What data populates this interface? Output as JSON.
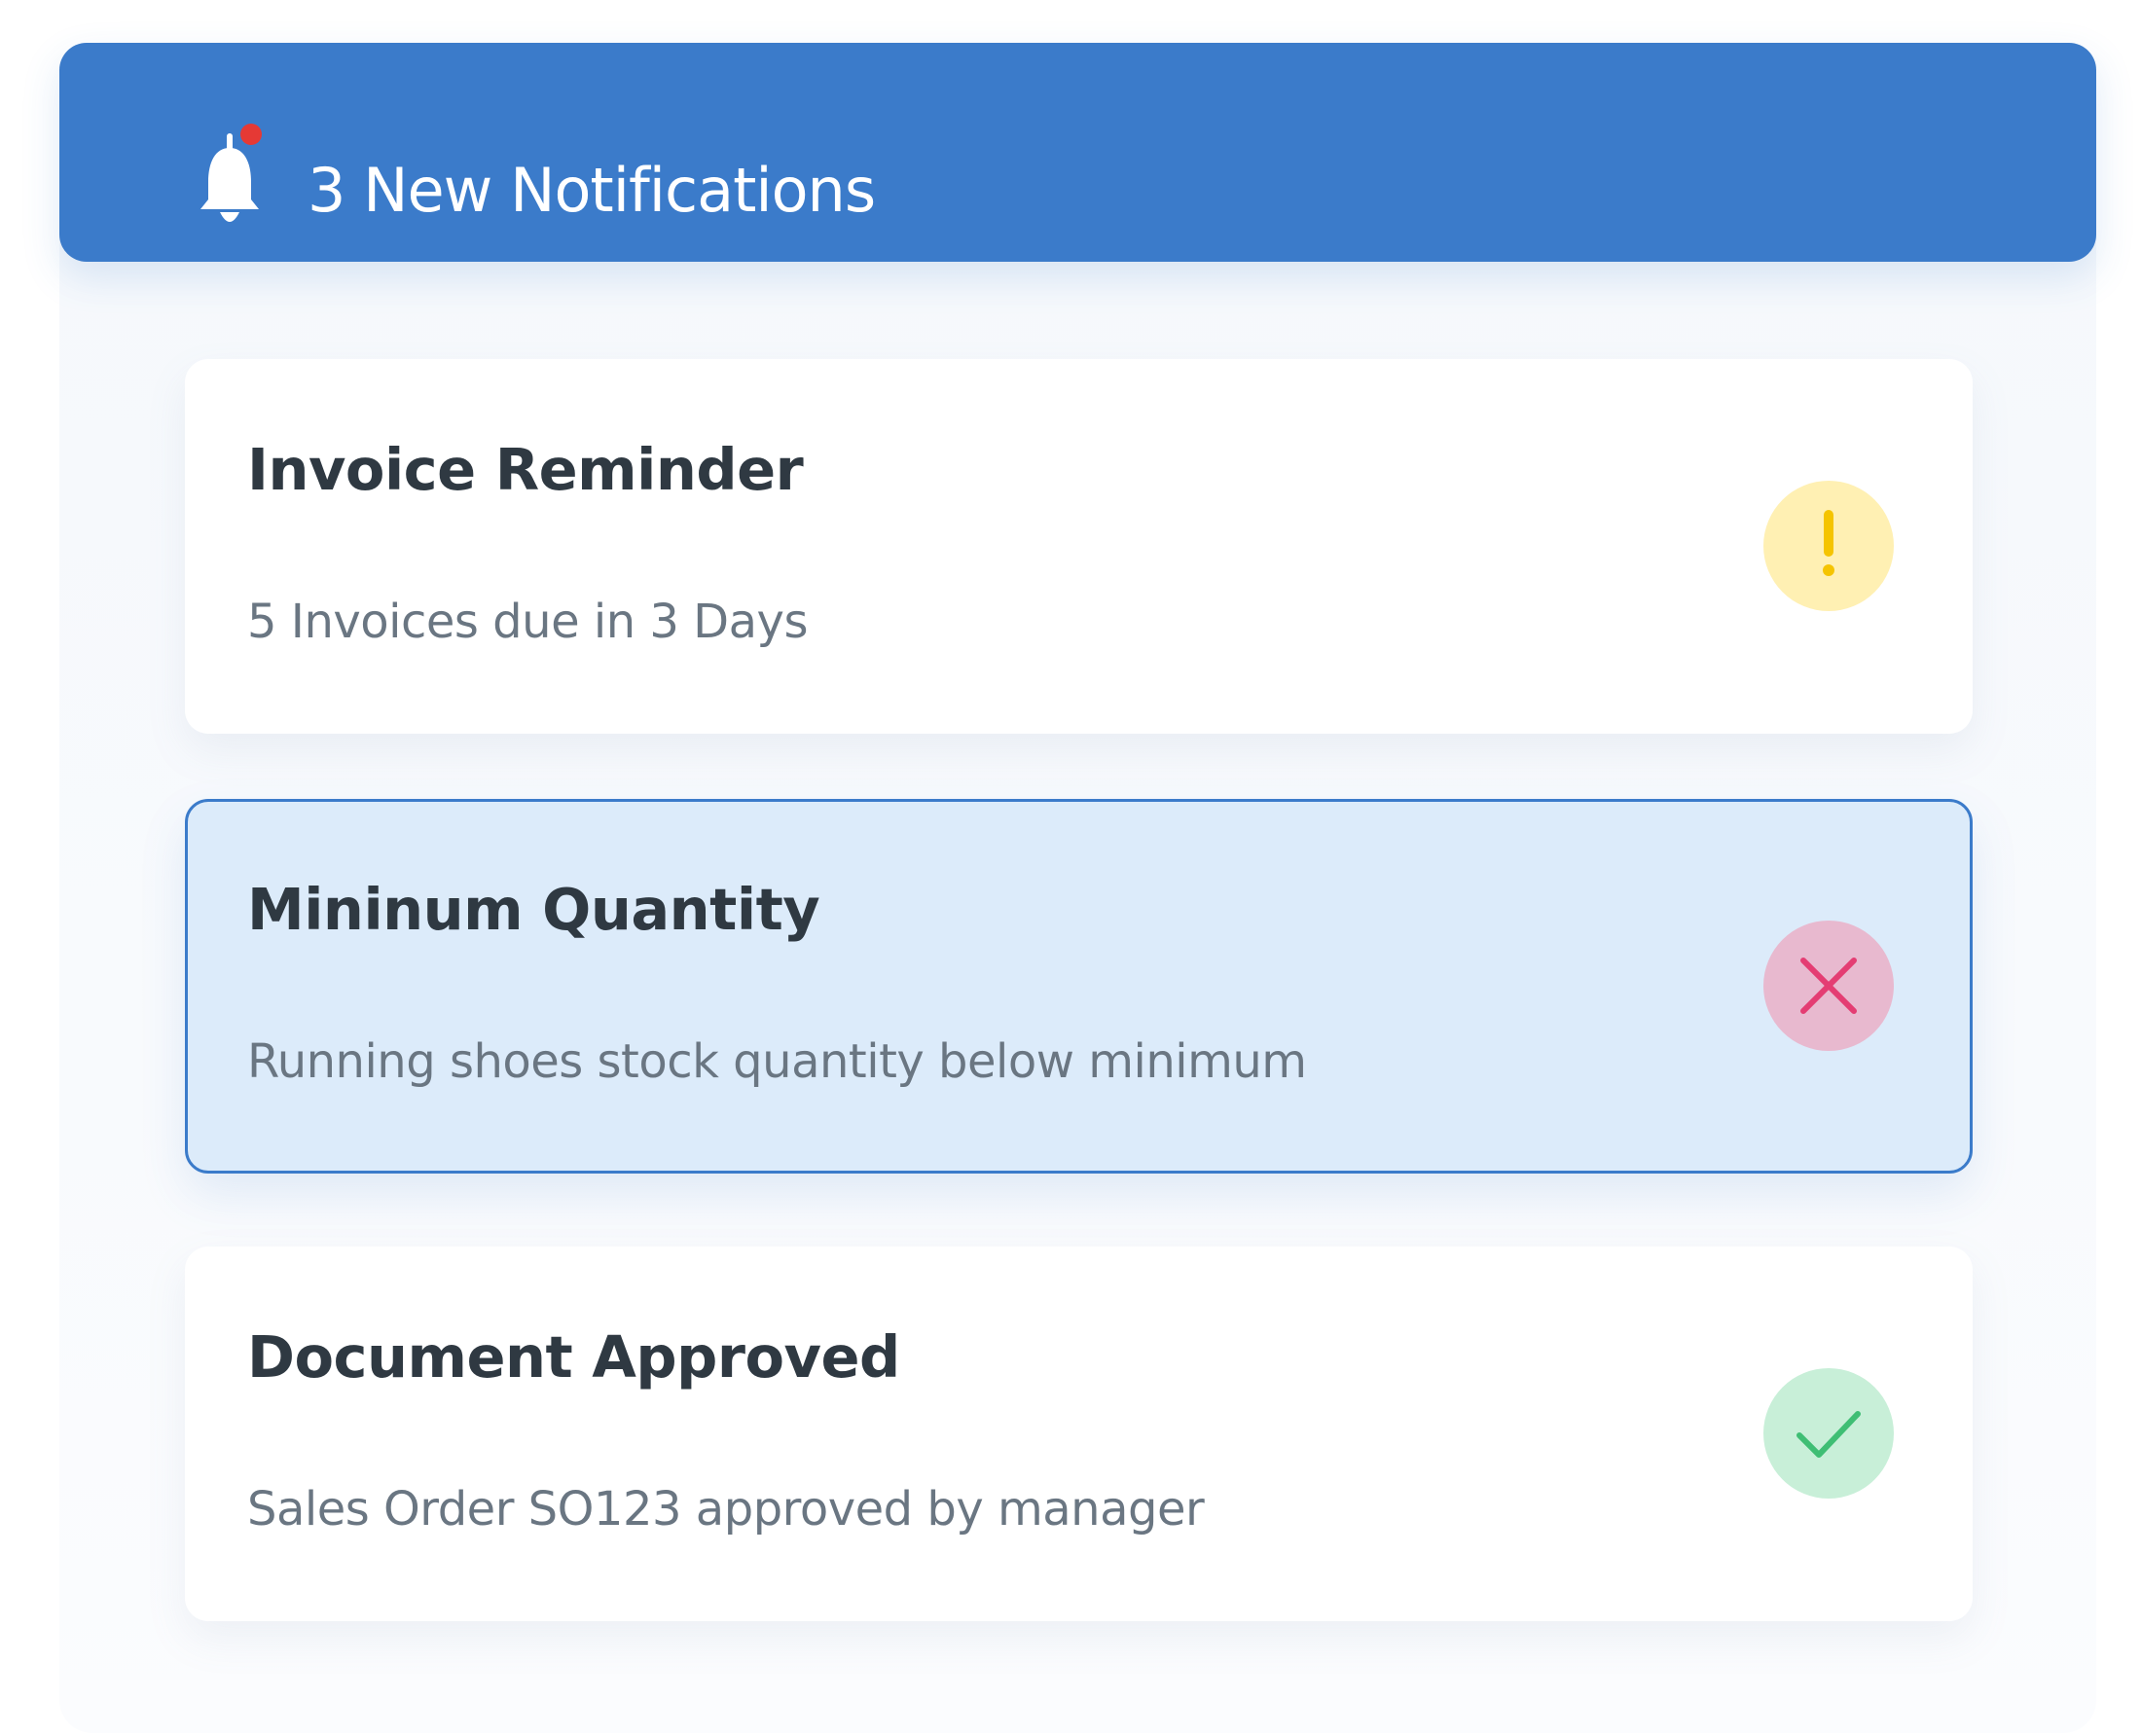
{
  "header": {
    "title": "3 New Notifications",
    "icon": "bell-icon",
    "accent": "#3b7bca",
    "dot_color": "#e53935"
  },
  "notifications": [
    {
      "title": "Invoice Reminder",
      "message": "5 Invoices due in 3 Days",
      "status": "warning",
      "icon": "exclamation-icon",
      "status_bg": "#fff0b3",
      "status_fg": "#f5c400",
      "selected": false
    },
    {
      "title": "Mininum Quantity",
      "message": "Running shoes stock quantity below minimum",
      "status": "error",
      "icon": "close-icon",
      "status_bg": "#e8b9cf",
      "status_fg": "#e43d73",
      "selected": true
    },
    {
      "title": "Document Approved",
      "message": "Sales Order SO123 approved by manager",
      "status": "success",
      "icon": "check-icon",
      "status_bg": "#c8efd8",
      "status_fg": "#3fbe74",
      "selected": false
    }
  ]
}
